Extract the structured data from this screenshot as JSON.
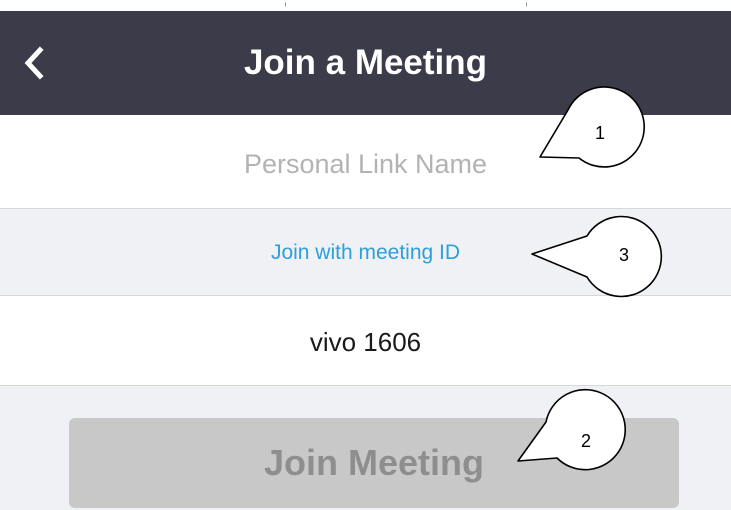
{
  "header": {
    "title": "Join a Meeting",
    "back_icon": "chevron-left-icon"
  },
  "personal_link": {
    "placeholder": "Personal Link Name",
    "value": ""
  },
  "meeting_id_link": {
    "label": "Join with meeting ID"
  },
  "name_field": {
    "value": "vivo 1606"
  },
  "join_button": {
    "label": "Join Meeting"
  },
  "callouts": [
    {
      "number": "1"
    },
    {
      "number": "2"
    },
    {
      "number": "3"
    }
  ],
  "colors": {
    "header_bg": "#3b3b49",
    "link_blue": "#2d9fd9",
    "button_disabled": "#c8c8c8",
    "button_text_disabled": "#8e8e8e",
    "row_alt_bg": "#f0f1f5"
  }
}
